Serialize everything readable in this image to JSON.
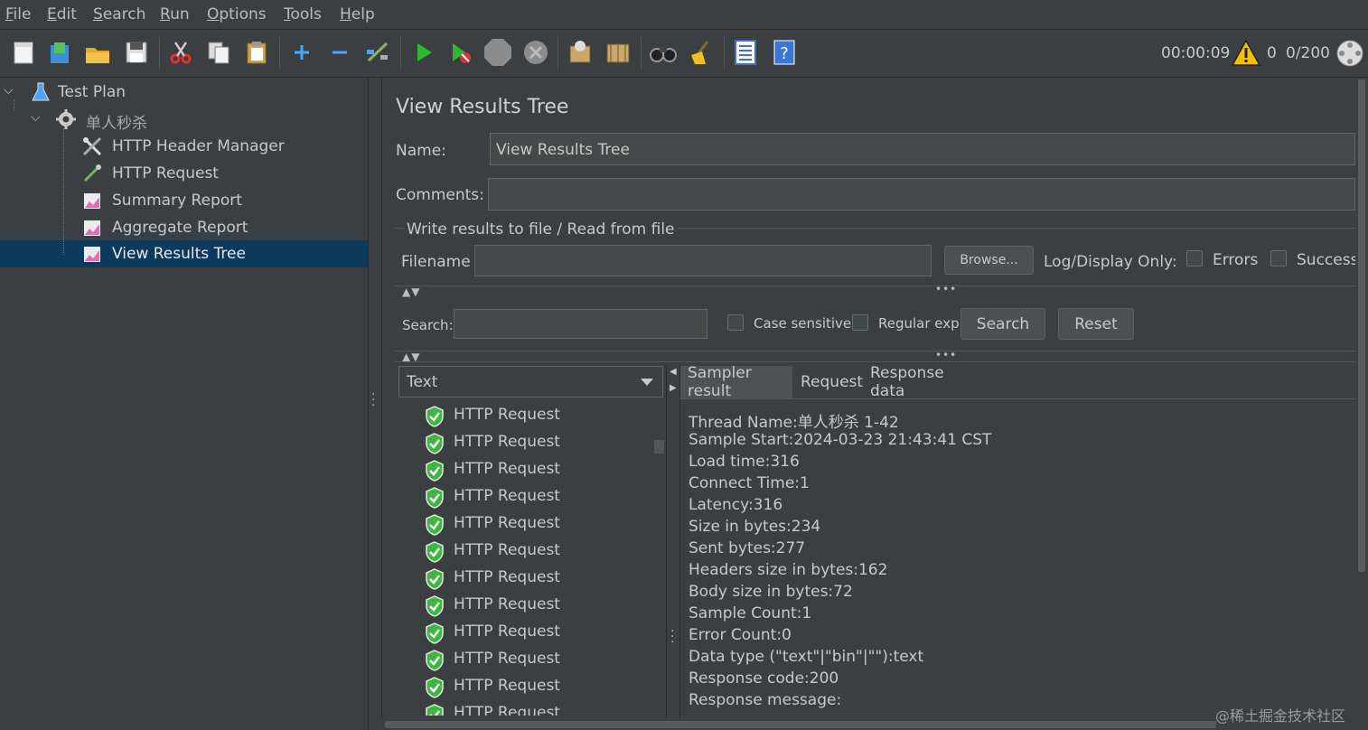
{
  "menu": {
    "items": [
      {
        "label_u": "F",
        "label_rest": "ile"
      },
      {
        "label_u": "E",
        "label_rest": "dit"
      },
      {
        "label_u": "S",
        "label_rest": "earch"
      },
      {
        "label_u": "R",
        "label_rest": "un"
      },
      {
        "label_u": "O",
        "label_rest": "ptions"
      },
      {
        "label_u": "T",
        "label_rest": "ools"
      },
      {
        "label_u": "H",
        "label_rest": "elp"
      }
    ]
  },
  "toolbar": {
    "timer": "00:00:09",
    "warning_count": "0",
    "thread_count": "0/200",
    "icons": [
      "new-icon",
      "templates-icon",
      "open-icon",
      "save-icon",
      "cut-icon",
      "copy-icon",
      "paste-icon",
      "expand-icon",
      "collapse-icon",
      "toggle-icon",
      "start-icon",
      "start-no-timers-icon",
      "stop-icon",
      "shutdown-icon",
      "clear-icon",
      "clear-all-icon",
      "search-icon",
      "reset-search-icon",
      "function-helper-icon",
      "help-icon"
    ]
  },
  "tree": {
    "items": [
      {
        "label": "Test Plan",
        "icon": "flask-icon"
      },
      {
        "label": "单人秒杀",
        "icon": "gear-icon"
      },
      {
        "label": "HTTP Header Manager",
        "icon": "tools-icon"
      },
      {
        "label": "HTTP Request",
        "icon": "pipette-icon"
      },
      {
        "label": "Summary Report",
        "icon": "chart-icon"
      },
      {
        "label": "Aggregate Report",
        "icon": "chart-icon"
      },
      {
        "label": "View Results Tree",
        "icon": "chart-icon"
      }
    ]
  },
  "panel": {
    "title": "View Results Tree",
    "name_label": "Name:",
    "name_value": "View Results Tree",
    "comments_label": "Comments:",
    "comments_value": "",
    "file_group_label": "Write results to file / Read from file",
    "filename_label": "Filename",
    "filename_value": "",
    "browse_label": "Browse...",
    "log_display_label": "Log/Display Only:",
    "errors_label": "Errors",
    "successes_label": "Successes",
    "search_label": "Search:",
    "search_value": "",
    "case_sensitive_label": "Case sensitive",
    "regular_exp_label": "Regular exp.",
    "search_button": "Search",
    "reset_button": "Reset",
    "renderer_select": "Text"
  },
  "results": {
    "items": [
      "HTTP Request",
      "HTTP Request",
      "HTTP Request",
      "HTTP Request",
      "HTTP Request",
      "HTTP Request",
      "HTTP Request",
      "HTTP Request",
      "HTTP Request",
      "HTTP Request",
      "HTTP Request",
      "HTTP Request"
    ]
  },
  "tabs": [
    "Sampler result",
    "Request",
    "Response data"
  ],
  "sampler": {
    "lines": [
      "Thread Name:单人秒杀 1-42",
      "Sample Start:2024-03-23 21:43:41 CST",
      "Load time:316",
      "Connect Time:1",
      "Latency:316",
      "Size in bytes:234",
      "Sent bytes:277",
      "Headers size in bytes:162",
      "Body size in bytes:72",
      "Sample Count:1",
      "Error Count:0",
      "Data type (\"text\"|\"bin\"|\"\"):text",
      "Response code:200",
      "Response message:"
    ]
  },
  "watermark": "@稀土掘金技术社区",
  "colors": {
    "accent": "#2f65ca",
    "selection": "#0d3a5c",
    "success": "#4caf50"
  }
}
